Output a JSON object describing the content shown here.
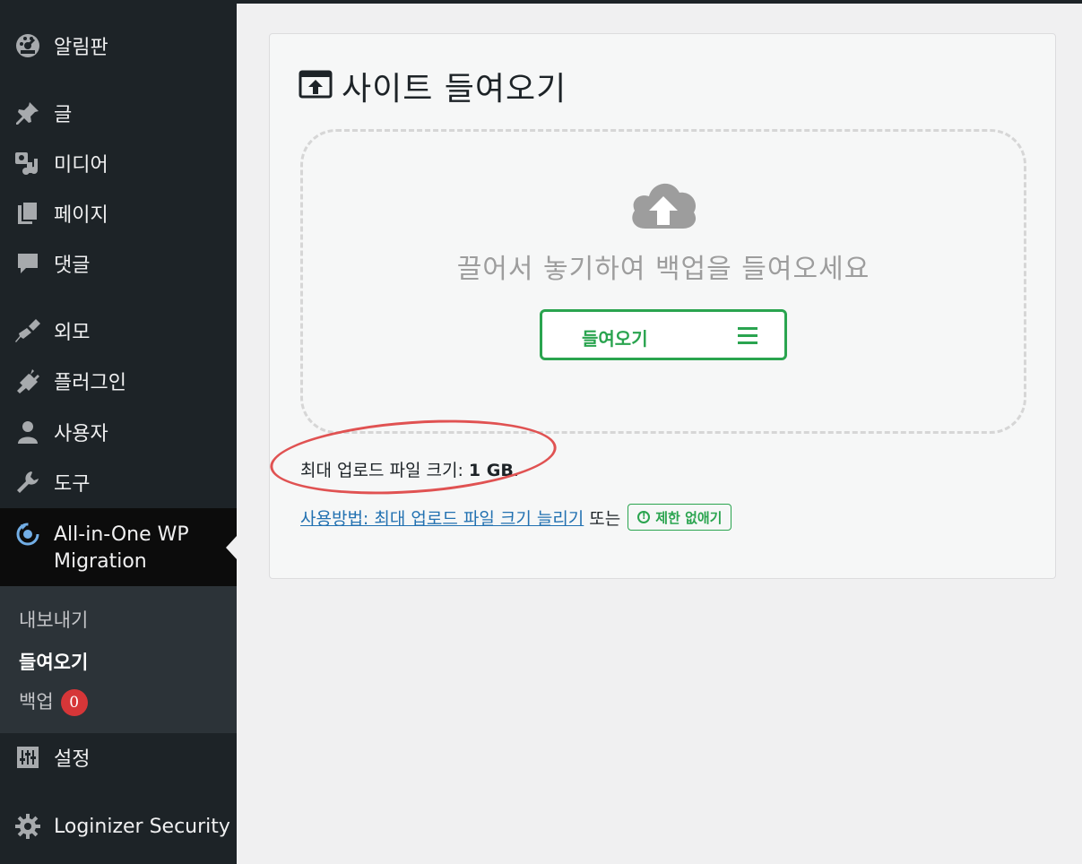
{
  "sidebar": {
    "items": [
      {
        "label": "알림판",
        "icon": "dashboard-icon"
      },
      {
        "label": "글",
        "icon": "pushpin-icon"
      },
      {
        "label": "미디어",
        "icon": "media-icon"
      },
      {
        "label": "페이지",
        "icon": "pages-icon"
      },
      {
        "label": "댓글",
        "icon": "comments-icon"
      },
      {
        "label": "외모",
        "icon": "appearance-icon"
      },
      {
        "label": "플러그인",
        "icon": "plugins-icon"
      },
      {
        "label": "사용자",
        "icon": "users-icon"
      },
      {
        "label": "도구",
        "icon": "tools-icon"
      },
      {
        "label_line1": "All-in-One WP",
        "label_line2": "Migration",
        "icon": "ai1wm-icon"
      },
      {
        "label": "설정",
        "icon": "settings-icon"
      },
      {
        "label": "Loginizer Security",
        "icon": "gear-icon"
      }
    ],
    "submenu": [
      {
        "label": "내보내기"
      },
      {
        "label": "들여오기"
      },
      {
        "label": "백업",
        "badge": "0"
      }
    ]
  },
  "panel": {
    "title": "사이트 들여오기",
    "drop_text": "끌어서 놓기하여 백업을 들여오세요",
    "import_button": "들여오기",
    "max_size_label": "최대 업로드 파일 크기:",
    "max_size_value": "1 GB",
    "max_size_suffix": ".",
    "howto_link": "사용방법: 최대 업로드 파일 크기 늘리기",
    "or_text": "또는",
    "unlimit_button": "제한 없애기"
  },
  "colors": {
    "sidebar_bg": "#1d2327",
    "active_bg": "#0c0c0c",
    "submenu_bg": "#2c3338",
    "accent_green": "#2aa44f",
    "badge_red": "#d63638",
    "link_blue": "#2271b1",
    "annotation_red": "#e05252"
  }
}
